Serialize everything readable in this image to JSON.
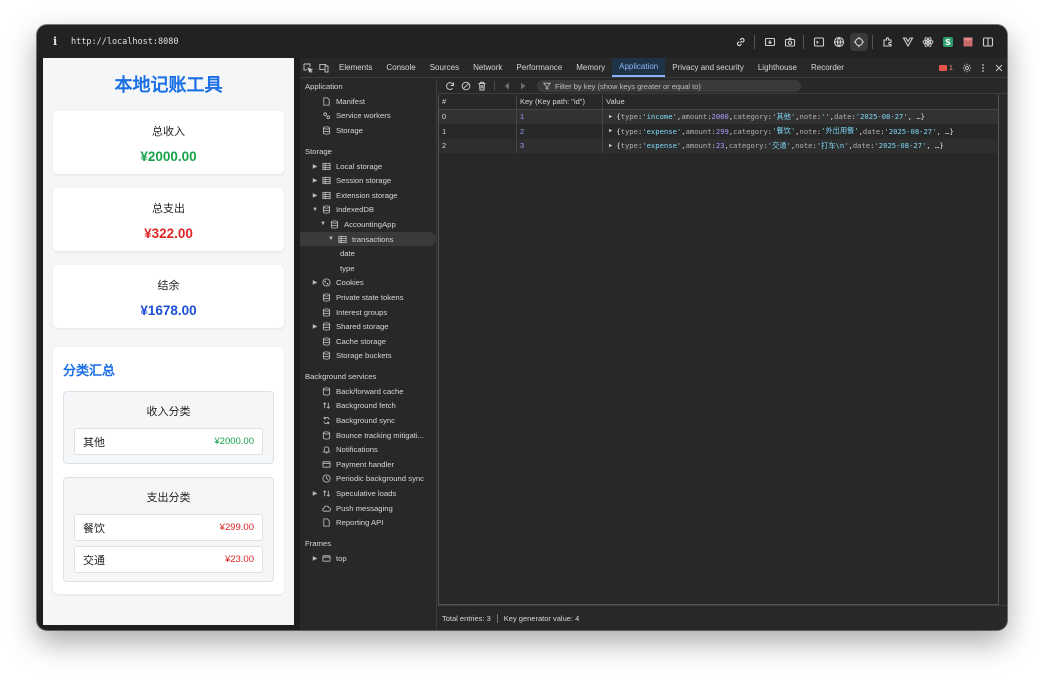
{
  "browser": {
    "url": "http://localhost:8080",
    "toolbar_icons": [
      "link-icon",
      "install-icon",
      "screenshot-icon",
      "terminal-icon",
      "globe-icon",
      "crosshair-icon",
      "extension-icon",
      "vue-icon",
      "react-icon",
      "s-extension-icon",
      "shop-icon",
      "split-view-icon"
    ]
  },
  "app": {
    "title": "本地记账工具",
    "stats": [
      {
        "label": "总收入",
        "value": "¥2000.00",
        "color": "#16a34a"
      },
      {
        "label": "总支出",
        "value": "¥322.00",
        "color": "#dc2626"
      },
      {
        "label": "结余",
        "value": "¥1678.00",
        "color": "#1d4ed8"
      }
    ],
    "summary_title": "分类汇总",
    "income": {
      "heading": "收入分类",
      "items": [
        {
          "name": "其他",
          "amount": "¥2000.00"
        }
      ]
    },
    "expense": {
      "heading": "支出分类",
      "items": [
        {
          "name": "餐饮",
          "amount": "¥299.00"
        },
        {
          "name": "交通",
          "amount": "¥23.00"
        }
      ]
    },
    "colors": {
      "income": "#16a34a",
      "expense": "#dc2626",
      "accent": "#1a6fe6"
    }
  },
  "devtools": {
    "tabs": [
      "Elements",
      "Console",
      "Sources",
      "Network",
      "Performance",
      "Memory",
      "Application",
      "Privacy and security",
      "Lighthouse",
      "Recorder"
    ],
    "active_tab": "Application",
    "issues_count": "1",
    "sidebar": {
      "application_head": "Application",
      "application_items": [
        "Manifest",
        "Service workers",
        "Storage"
      ],
      "storage_head": "Storage",
      "storage_items": [
        "Local storage",
        "Session storage",
        "Extension storage",
        "IndexedDB",
        "AccountingApp",
        "transactions",
        "date",
        "type",
        "Cookies",
        "Private state tokens",
        "Interest groups",
        "Shared storage",
        "Cache storage",
        "Storage buckets"
      ],
      "background_head": "Background services",
      "background_items": [
        "Back/forward cache",
        "Background fetch",
        "Background sync",
        "Bounce tracking mitigati...",
        "Notifications",
        "Payment handler",
        "Periodic background sync",
        "Speculative loads",
        "Push messaging",
        "Reporting API"
      ],
      "frames_head": "Frames",
      "frames_items": [
        "top"
      ]
    },
    "filter_placeholder": "Filter by key (show keys greater or equal to)",
    "table": {
      "headers": [
        "#",
        "Key (Key path: \"id\")",
        "Value"
      ],
      "rows": [
        {
          "index": "0",
          "key": "1",
          "type": "income",
          "amount": "2000",
          "category": "其他",
          "note": "",
          "date": "2025-08-27"
        },
        {
          "index": "1",
          "key": "2",
          "type": "expense",
          "amount": "299",
          "category": "餐饮",
          "note": "外出用餐",
          "date": "2025-08-27"
        },
        {
          "index": "2",
          "key": "3",
          "type": "expense",
          "amount": "23",
          "category": "交通",
          "note": "打车\\n",
          "date": "2025-08-27"
        }
      ]
    },
    "status": {
      "total_entries": "Total entries: 3",
      "key_generator": "Key generator value: 4"
    }
  }
}
